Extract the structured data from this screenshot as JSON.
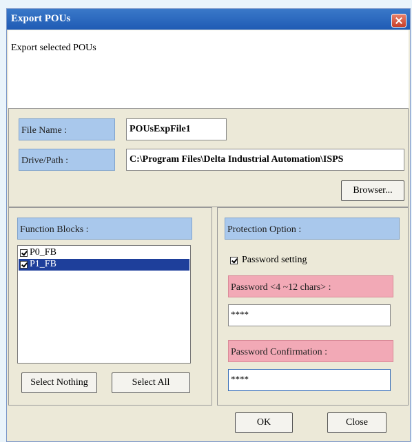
{
  "dialog": {
    "title": "Export POUs",
    "description": "Export selected POUs"
  },
  "file": {
    "name_label": "File Name :",
    "name_value": "POUsExpFile1",
    "path_label": "Drive/Path :",
    "path_value": "C:\\Program Files\\Delta Industrial Automation\\ISPS",
    "browse_label": "Browser..."
  },
  "function_blocks": {
    "label": "Function Blocks :",
    "items": [
      {
        "name": "P0_FB",
        "checked": true,
        "selected": false
      },
      {
        "name": "P1_FB",
        "checked": true,
        "selected": true
      }
    ],
    "select_nothing_label": "Select Nothing",
    "select_all_label": "Select All"
  },
  "protection": {
    "label": "Protection Option :",
    "password_setting_label": "Password setting",
    "password_setting_checked": true,
    "password_label": "Password <4 ~12 chars> :",
    "password_value": "****",
    "confirm_label": "Password Confirmation :",
    "confirm_value": "****"
  },
  "footer": {
    "ok_label": "OK",
    "close_label": "Close"
  },
  "icons": [
    "close-icon",
    "checkbox-icon"
  ],
  "colors": {
    "titlebar": "#2a67be",
    "label_blue": "#a9c8ec",
    "label_pink": "#f2a9b6",
    "selection": "#1e3f9b"
  }
}
